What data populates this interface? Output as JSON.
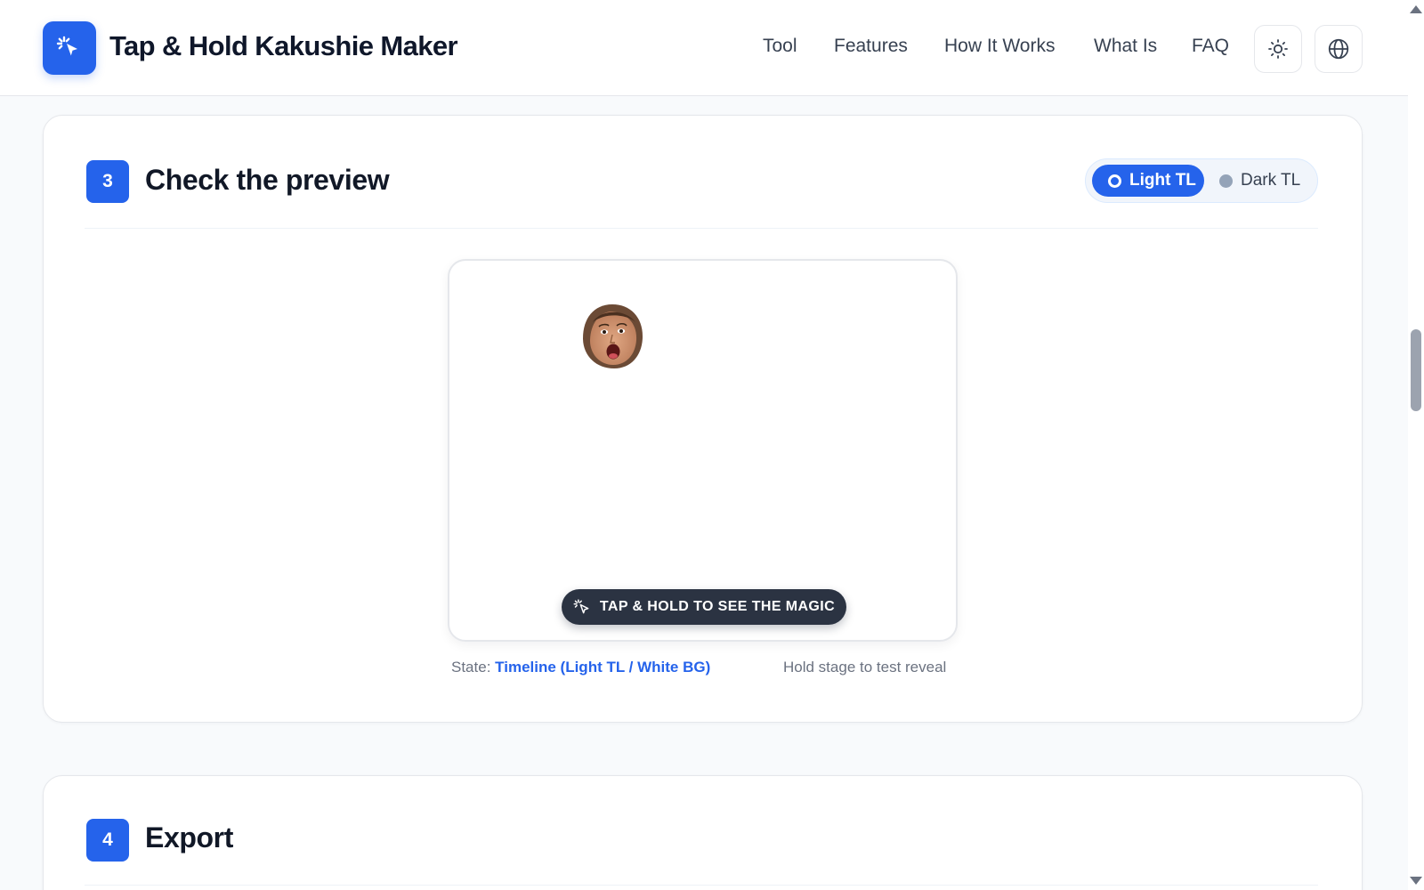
{
  "header": {
    "brand": "Tap & Hold Kakushie Maker",
    "logo_icon": "tap-sparkle-cursor-icon",
    "nav": [
      "Tool",
      "Features",
      "How It Works",
      "What Is",
      "FAQ"
    ],
    "theme_icon": "sun-icon",
    "language_icon": "globe-icon"
  },
  "step3": {
    "number": "3",
    "title": "Check the preview",
    "toggle": {
      "options": [
        "Light TL",
        "Dark TL"
      ],
      "selected": "Light TL"
    },
    "stage": {
      "cta": "TAP & HOLD TO SEE THE MAGIC",
      "cta_icon": "tap-cursor-icon",
      "image": "surprised-face-sticker"
    },
    "state_label": "State:",
    "state_value": "Timeline (Light TL / White BG)",
    "hint": "Hold stage to test reveal"
  },
  "step4": {
    "number": "4",
    "title": "Export"
  },
  "colors": {
    "accent": "#2563eb",
    "pill_dark": "#2b3342",
    "page_bg": "#f8fafc"
  }
}
